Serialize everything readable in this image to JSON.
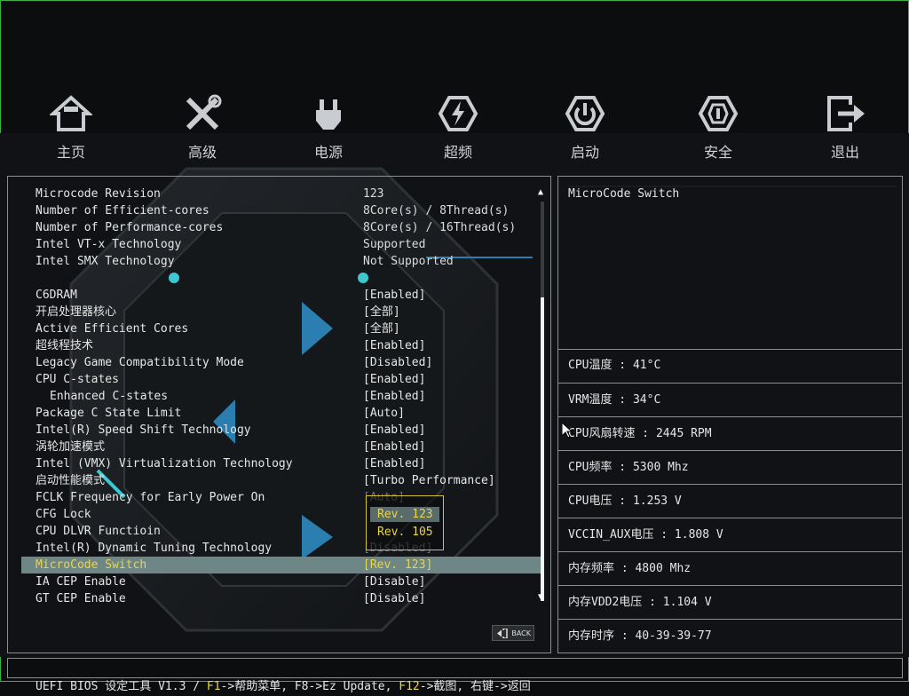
{
  "nav": [
    {
      "label": "主页",
      "icon": "home-icon"
    },
    {
      "label": "高级",
      "icon": "tools-icon"
    },
    {
      "label": "电源",
      "icon": "power-plug-icon"
    },
    {
      "label": "超频",
      "icon": "overclock-icon"
    },
    {
      "label": "启动",
      "icon": "power-icon"
    },
    {
      "label": "安全",
      "icon": "shield-icon"
    },
    {
      "label": "退出",
      "icon": "exit-icon"
    }
  ],
  "settings": [
    {
      "label": "Microcode Revision",
      "value": "123",
      "kind": "info"
    },
    {
      "label": "Number of Efficient-cores",
      "value": "8Core(s) / 8Thread(s)",
      "kind": "info"
    },
    {
      "label": "Number of Performance-cores",
      "value": "8Core(s) / 16Thread(s)",
      "kind": "info"
    },
    {
      "label": "Intel VT-x Technology",
      "value": "Supported",
      "kind": "info"
    },
    {
      "label": "Intel SMX Technology",
      "value": "Not Supported",
      "kind": "info"
    },
    {
      "label": "",
      "value": "",
      "kind": "blank"
    },
    {
      "label": "C6DRAM",
      "value": "[Enabled]",
      "kind": "option"
    },
    {
      "label": "开启处理器核心",
      "value": "[全部]",
      "kind": "option"
    },
    {
      "label": "Active Efficient Cores",
      "value": "[全部]",
      "kind": "option"
    },
    {
      "label": "超线程技术",
      "value": "[Enabled]",
      "kind": "option"
    },
    {
      "label": "Legacy Game Compatibility Mode",
      "value": "[Disabled]",
      "kind": "option"
    },
    {
      "label": "CPU C-states",
      "value": "[Enabled]",
      "kind": "option"
    },
    {
      "label": "Enhanced C-states",
      "value": "[Enabled]",
      "kind": "option",
      "sub": true
    },
    {
      "label": "Package C State Limit",
      "value": "[Auto]",
      "kind": "option"
    },
    {
      "label": "Intel(R) Speed Shift Technology",
      "value": "[Enabled]",
      "kind": "option"
    },
    {
      "label": "涡轮加速模式",
      "value": "[Enabled]",
      "kind": "option"
    },
    {
      "label": "Intel (VMX) Virtualization Technology",
      "value": "[Enabled]",
      "kind": "option"
    },
    {
      "label": "启动性能模式",
      "value": "[Turbo Performance]",
      "kind": "option"
    },
    {
      "label": "FCLK Frequency for Early Power On",
      "value": "[Auto]",
      "kind": "option",
      "dim": true
    },
    {
      "label": "CFG Lock",
      "value": "",
      "kind": "option"
    },
    {
      "label": "CPU DLVR Functioin",
      "value": "",
      "kind": "option"
    },
    {
      "label": "Intel(R) Dynamic Tuning Technology",
      "value": "[Disabled]",
      "kind": "option",
      "dim": true
    },
    {
      "label": "MicroCode Switch",
      "value": "[Rev. 123]",
      "kind": "option",
      "selected": true
    },
    {
      "label": "IA CEP Enable",
      "value": "[Disable]",
      "kind": "option"
    },
    {
      "label": "GT CEP Enable",
      "value": "[Disable]",
      "kind": "option"
    }
  ],
  "popup": {
    "options": [
      "Rev. 123",
      "Rev. 105"
    ],
    "selected": "Rev. 123"
  },
  "back_button": {
    "label": "BACK"
  },
  "help": {
    "text": "MicroCode Switch"
  },
  "sensors": [
    "CPU温度 : 41°C",
    "VRM温度 : 34°C",
    "CPU风扇转速 : 2445 RPM",
    "CPU频率 : 5300 Mhz",
    "CPU电压 : 1.253 V",
    "VCCIN_AUX电压 : 1.808 V",
    "内存频率 : 4800 Mhz",
    "内存VDD2电压 : 1.104 V",
    "内存时序 : 40-39-39-77"
  ],
  "status": {
    "prefix": "UEFI BIOS 设定工具 V1.3 / ",
    "k1": "F1",
    "t1": "->帮助菜单, F8->Ez Update, ",
    "k2": "F12",
    "t2": "->截图, 右键->返回"
  },
  "colors": {
    "accent": "#e9d64a",
    "selected_bg": "#6f8686",
    "frame": "#3cb043"
  }
}
